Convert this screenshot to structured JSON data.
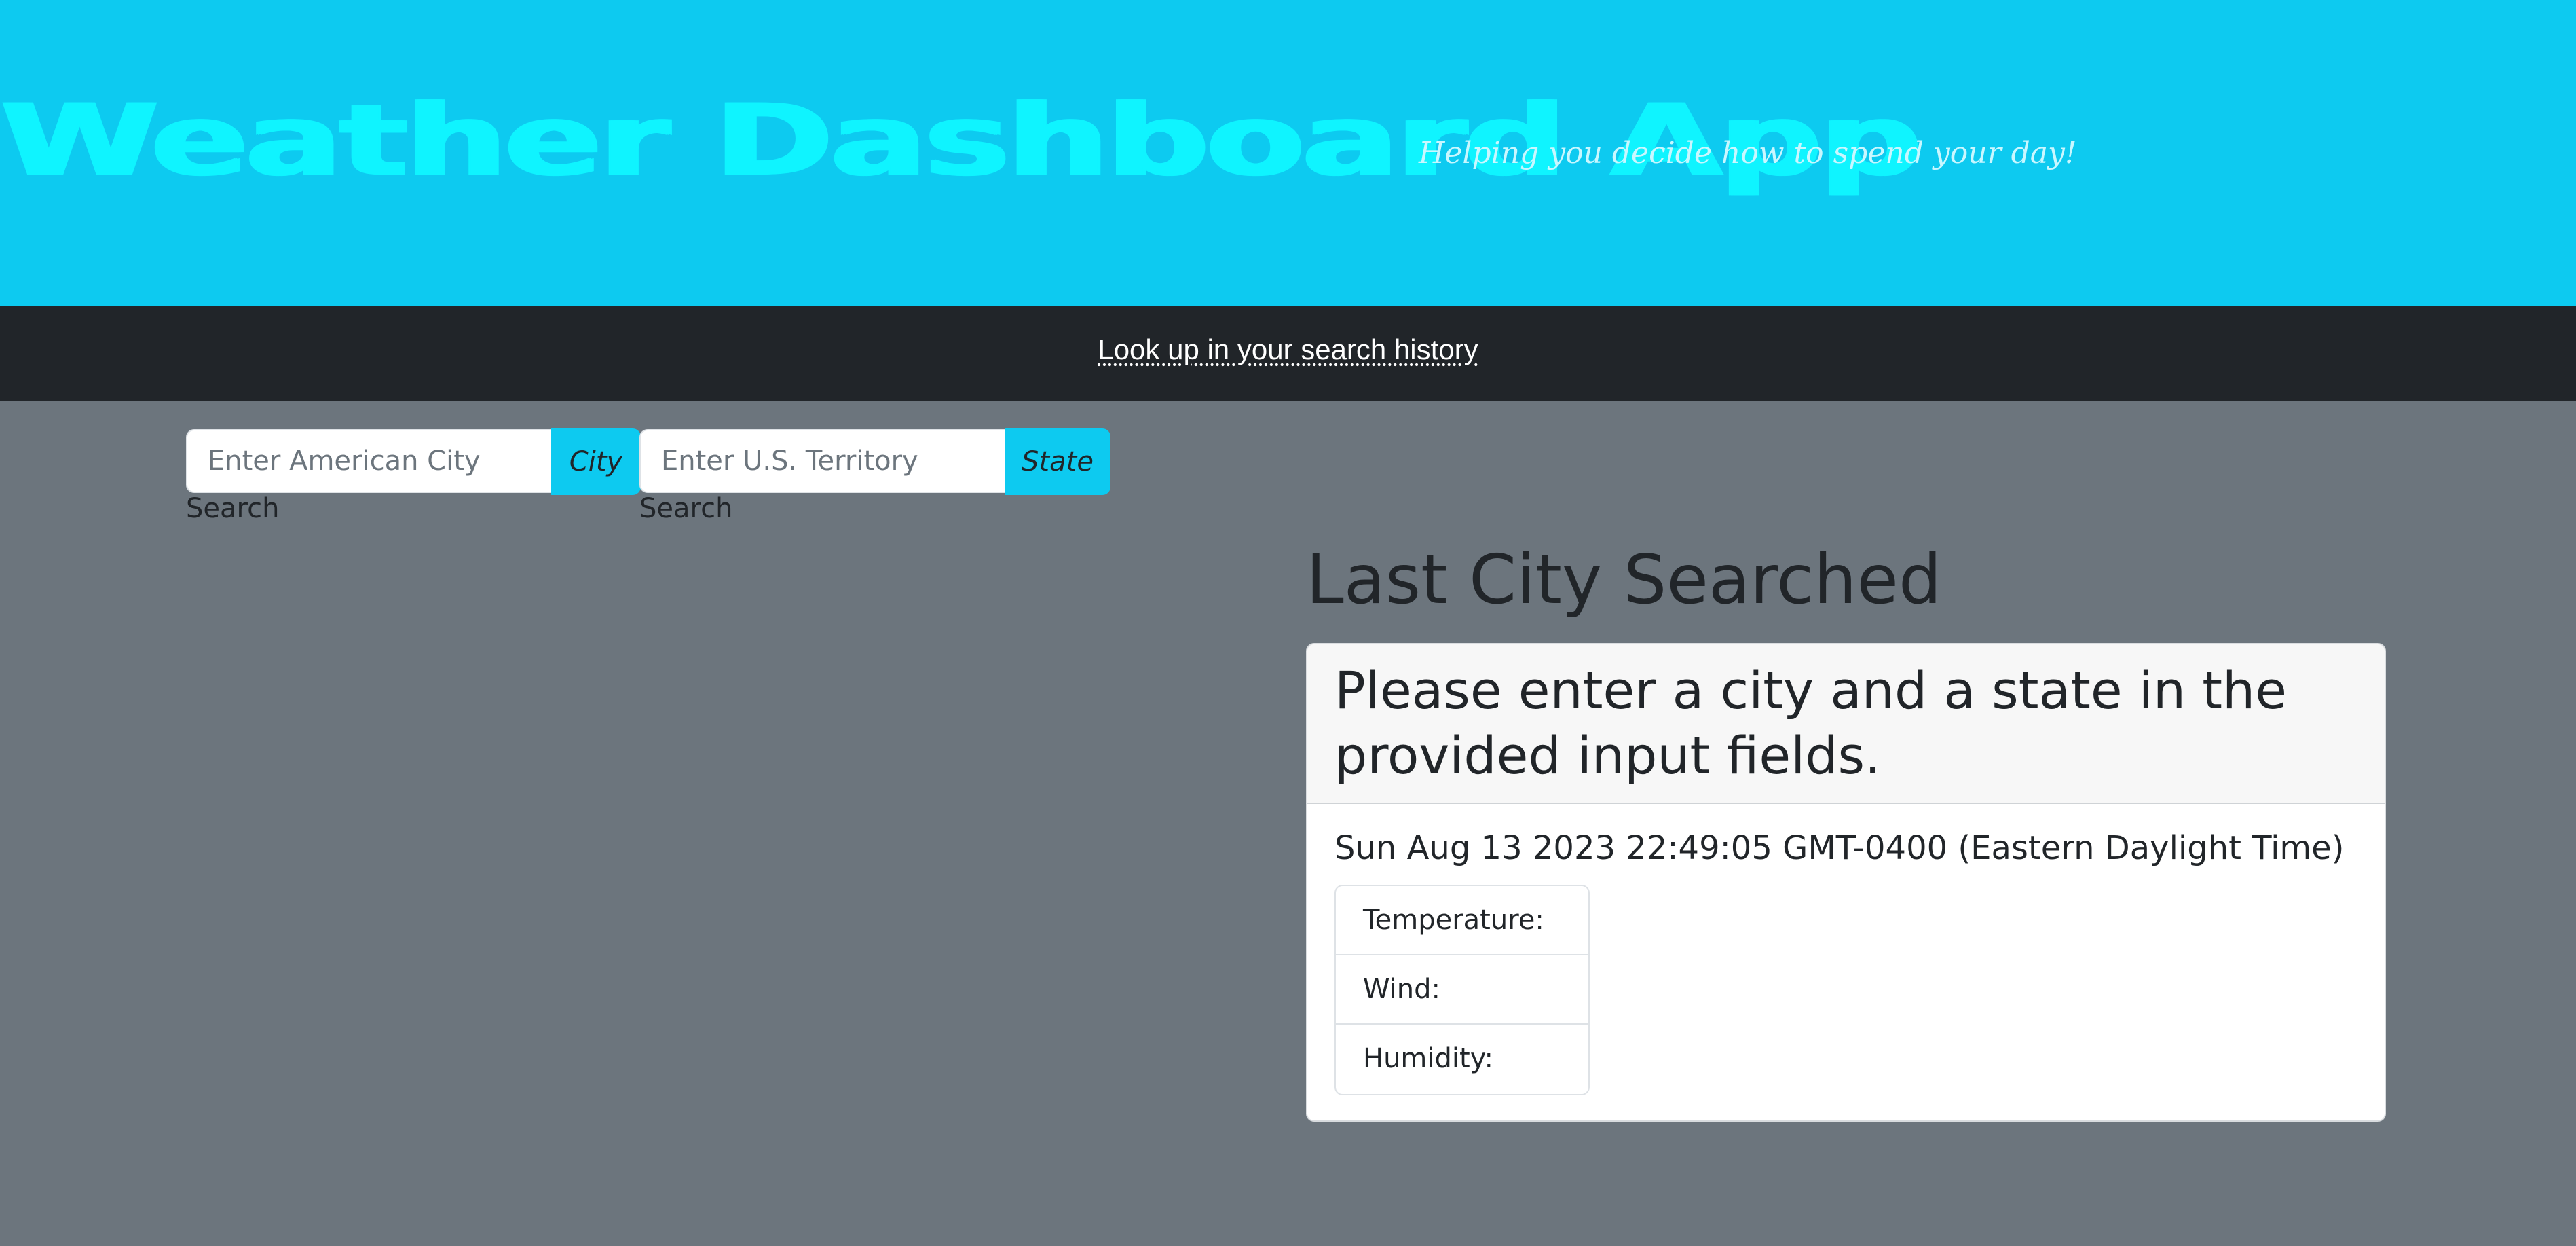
{
  "header": {
    "title": "Weather Dashboard App",
    "tagline": "Helping you decide how to spend your day!"
  },
  "navbar": {
    "history_link": "Look up in your search history"
  },
  "city_search": {
    "placeholder": "Enter American City",
    "button_label": "City",
    "label": "Search"
  },
  "state_search": {
    "placeholder": "Enter U.S. Territory",
    "button_label": "State",
    "label": "Search"
  },
  "results": {
    "section_title": "Last City Searched",
    "card_header": "Please enter a city and a state in the provided input fields.",
    "date": "Sun Aug 13 2023 22:49:05 GMT-0400 (Eastern Daylight Time)",
    "stats": [
      {
        "label": "Temperature:"
      },
      {
        "label": "Wind:"
      },
      {
        "label": "Humidity:"
      }
    ]
  },
  "colors": {
    "header_bg": "#0dcaf0",
    "title_color": "#0ff4ff",
    "navbar_bg": "#212529",
    "page_bg": "#6c757d",
    "button_bg": "#0dcaf0"
  }
}
